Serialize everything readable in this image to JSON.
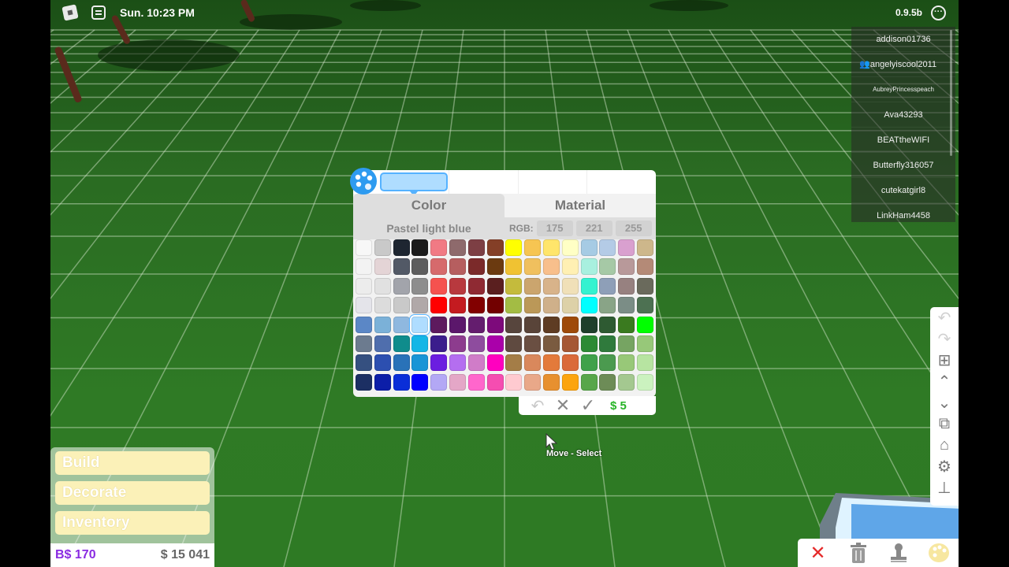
{
  "status": {
    "clock": "Sun. 10:23 PM",
    "version": "0.9.5b",
    "menu_glyph": "···"
  },
  "players": [
    {
      "name": "addison01736",
      "friend": false,
      "small": false
    },
    {
      "name": "angelyiscool2011",
      "friend": true,
      "small": false
    },
    {
      "name": "AubreyPrincesspeach",
      "friend": false,
      "small": true
    },
    {
      "name": "Ava43293",
      "friend": false,
      "small": false
    },
    {
      "name": "BEATtheWIFI",
      "friend": false,
      "small": false
    },
    {
      "name": "Butterfly316057",
      "friend": false,
      "small": false
    },
    {
      "name": "cutekatgirl8",
      "friend": false,
      "small": false
    },
    {
      "name": "LinkHam4458",
      "friend": false,
      "small": false
    }
  ],
  "picker": {
    "tabs": {
      "color": "Color",
      "material": "Material"
    },
    "color_name": "Pastel light blue",
    "rgb_label": "RGB:",
    "rgb": [
      "175",
      "221",
      "255"
    ],
    "selected_color": "#afddff",
    "price": "$ 5",
    "swatches": [
      [
        "#f7f7f7",
        "#c9c9c9",
        "#1e2631",
        "#1b1b1b",
        "#f17a84",
        "#8e6a6c",
        "#7d3f44",
        "#843f27",
        "#ffff00",
        "#f6c552",
        "#ffe56b",
        "#ffffc5",
        "#a6cbe4",
        "#b4cbe6",
        "#d9a0cf",
        "#cdb78b"
      ],
      [
        "#f3f3f3",
        "#e4d4d6",
        "#525966",
        "#5d5d5d",
        "#d66a6c",
        "#b65e5f",
        "#7b2a2a",
        "#6b3a10",
        "#f0c232",
        "#f0c05e",
        "#f8bf8c",
        "#fff0b3",
        "#a8f0df",
        "#a6c9a6",
        "#b8999a",
        "#b48a77"
      ],
      [
        "#ececec",
        "#e1e1e1",
        "#a2a4ab",
        "#8d8d8d",
        "#f5524f",
        "#b8393e",
        "#8f2a33",
        "#5a1f1f",
        "#c4bb3c",
        "#cba56e",
        "#d8b38a",
        "#f0e0b8",
        "#34f2d0",
        "#8e9fb8",
        "#978180",
        "#6a6a5c"
      ],
      [
        "#e4e4ea",
        "#dcdcdc",
        "#c9c9c9",
        "#b0a8a8",
        "#ff0000",
        "#c41b20",
        "#820000",
        "#720000",
        "#a3bc44",
        "#bb9858",
        "#cfb08a",
        "#ddd1a8",
        "#00ffff",
        "#89a487",
        "#7b8d86",
        "#4d7152"
      ],
      [
        "#5b87c6",
        "#7bb1d8",
        "#8fb8df",
        "#afddff",
        "#5d1a5e",
        "#5b176b",
        "#641d6e",
        "#7d0a7b",
        "#57453d",
        "#594439",
        "#5e3c23",
        "#9e4a0a",
        "#1f3f2b",
        "#2e5a32",
        "#3a7a1f",
        "#00ff00"
      ],
      [
        "#6c7b8f",
        "#4f6ead",
        "#0f8c8c",
        "#14b6e6",
        "#3b1d8c",
        "#8d3c8e",
        "#8e4c9e",
        "#aa00aa",
        "#5f4a40",
        "#6a4f42",
        "#7a5b40",
        "#a55734",
        "#2c8a34",
        "#2f7a3c",
        "#76a462",
        "#97c879"
      ],
      [
        "#355080",
        "#2c4fb0",
        "#2972b8",
        "#1995d6",
        "#6b1ee0",
        "#b46ef0",
        "#d07cc8",
        "#ff00bf",
        "#a47d47",
        "#d9885c",
        "#e37a3b",
        "#da6a3a",
        "#3fa14a",
        "#4b9a4f",
        "#98c878",
        "#b7e4a1"
      ],
      [
        "#1c2f63",
        "#0c1ea8",
        "#0a2ed8",
        "#0000ff",
        "#b3a8f5",
        "#e4a7c7",
        "#ff66cc",
        "#f54db1",
        "#ffcad0",
        "#e9a889",
        "#e7902f",
        "#fca40f",
        "#58a64a",
        "#6d8c57",
        "#a4c890",
        "#cbf2bf"
      ]
    ]
  },
  "tooltip": "Move - Select",
  "menu": {
    "build": "Build",
    "decorate": "Decorate",
    "inventory": "Inventory"
  },
  "money": {
    "bucks": "B$ 170",
    "cash": "$ 15 041"
  },
  "tools": [
    "undo-icon",
    "redo-icon",
    "grid-icon",
    "chevron-up-icon",
    "chevron-down-icon",
    "clone-icon",
    "home-icon",
    "gear-icon",
    "stamp-icon"
  ],
  "bottom_tools": [
    "close-icon",
    "trash-icon",
    "paint-stamp-icon",
    "palette-icon"
  ]
}
